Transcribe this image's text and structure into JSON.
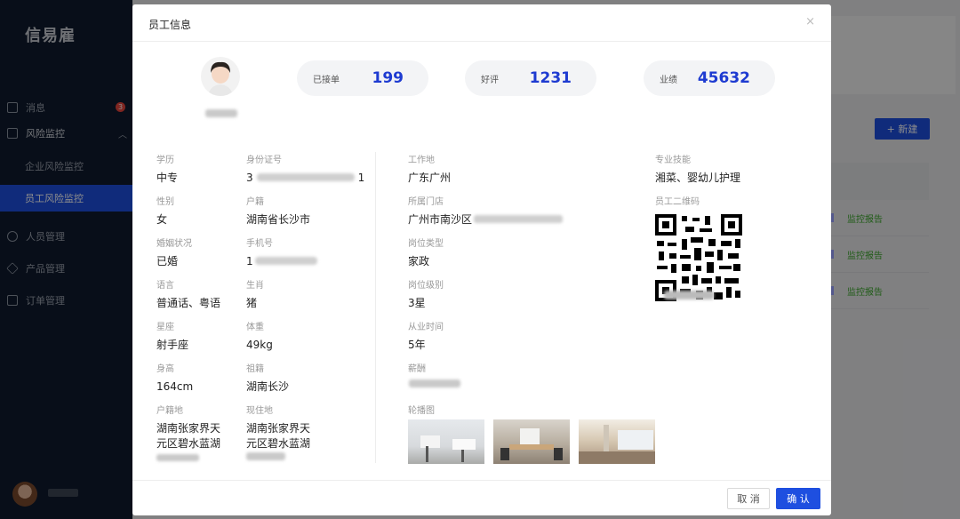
{
  "app": {
    "logo": "信易雇"
  },
  "sidebar": {
    "items": [
      {
        "label": "消息",
        "badge": "3"
      },
      {
        "label": "风险监控"
      },
      {
        "label": "企业风险监控"
      },
      {
        "label": "员工风险监控"
      },
      {
        "label": "人员管理"
      },
      {
        "label": "产品管理"
      },
      {
        "label": "订单管理"
      }
    ]
  },
  "background": {
    "new_button": "+ 新建",
    "report_links": [
      "监控报告",
      "监控报告",
      "监控报告"
    ]
  },
  "modal": {
    "title": "员工信息",
    "close": "×",
    "stats": [
      {
        "label": "已接单",
        "value": "199"
      },
      {
        "label": "好评",
        "value": "1231"
      },
      {
        "label": "业绩",
        "value": "45632"
      }
    ],
    "fields": {
      "education": {
        "label": "学历",
        "value": "中专"
      },
      "id_number": {
        "label": "身份证号",
        "prefix": "3",
        "suffix": "1"
      },
      "gender": {
        "label": "性别",
        "value": "女"
      },
      "household": {
        "label": "户籍",
        "value": "湖南省长沙市"
      },
      "marital": {
        "label": "婚姻状况",
        "value": "已婚"
      },
      "phone": {
        "label": "手机号",
        "prefix": "1"
      },
      "language": {
        "label": "语言",
        "value": "普通话、粤语"
      },
      "zodiac": {
        "label": "生肖",
        "value": "猪"
      },
      "constellation": {
        "label": "星座",
        "value": "射手座"
      },
      "weight": {
        "label": "体重",
        "value": "49kg"
      },
      "height": {
        "label": "身高",
        "value": "164cm"
      },
      "hometown": {
        "label": "祖籍",
        "value": "湖南长沙"
      },
      "birthplace": {
        "label": "户籍地",
        "value": "湖南张家界天元区碧水蓝湖"
      },
      "residence": {
        "label": "现住地",
        "value": "湖南张家界天元区碧水蓝湖"
      },
      "workplace": {
        "label": "工作地",
        "value": "广东广州"
      },
      "store": {
        "label": "所属门店",
        "value": "广州市南沙区"
      },
      "job_type": {
        "label": "岗位类型",
        "value": "家政"
      },
      "job_level": {
        "label": "岗位级别",
        "value": "3星"
      },
      "experience": {
        "label": "从业时间",
        "value": "5年"
      },
      "salary": {
        "label": "薪酬"
      },
      "carousel": {
        "label": "轮播图"
      },
      "skills": {
        "label": "专业技能",
        "value": "湘菜、婴幼儿护理"
      },
      "qrcode": {
        "label": "员工二维码"
      }
    },
    "cancel": "取 消",
    "confirm": "确 认"
  }
}
